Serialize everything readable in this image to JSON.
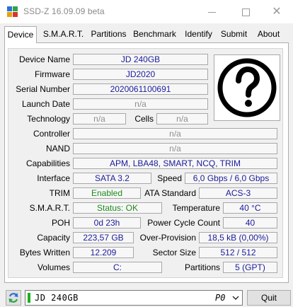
{
  "window": {
    "title": "SSD-Z 16.09.09 beta"
  },
  "tabs": [
    {
      "label": "Device"
    },
    {
      "label": "S.M.A.R.T."
    },
    {
      "label": "Partitions"
    },
    {
      "label": "Benchmark"
    },
    {
      "label": "Identify"
    },
    {
      "label": "Submit"
    },
    {
      "label": "About"
    }
  ],
  "device": {
    "device_name_label": "Device Name",
    "device_name": "JD 240GB",
    "firmware_label": "Firmware",
    "firmware": "JD2020",
    "serial_label": "Serial Number",
    "serial": "2020061100691",
    "launch_label": "Launch Date",
    "launch": "n/a",
    "technology_label": "Technology",
    "technology": "n/a",
    "cells_label": "Cells",
    "cells": "n/a",
    "controller_label": "Controller",
    "controller": "n/a",
    "nand_label": "NAND",
    "nand": "n/a",
    "capabilities_label": "Capabilities",
    "capabilities": "APM, LBA48, SMART, NCQ, TRIM",
    "interface_label": "Interface",
    "interface": "SATA 3.2",
    "speed_label": "Speed",
    "speed": "6,0 Gbps / 6,0 Gbps",
    "trim_label": "TRIM",
    "trim": "Enabled",
    "ata_label": "ATA Standard",
    "ata": "ACS-3",
    "smart_label": "S.M.A.R.T.",
    "smart": "Status: OK",
    "temp_label": "Temperature",
    "temp": "40 °C",
    "poh_label": "POH",
    "poh": "0d 23h",
    "pcc_label": "Power Cycle Count",
    "pcc": "40",
    "capacity_label": "Capacity",
    "capacity": "223,57 GB",
    "overprov_label": "Over-Provision",
    "overprov": "18,5 kB (0,00%)",
    "bytes_label": "Bytes Written",
    "bytes": "12.209",
    "sector_label": "Sector Size",
    "sector": "512 / 512",
    "volumes_label": "Volumes",
    "volumes": "C:",
    "partitions_label": "Partitions",
    "partitions": "5 (GPT)"
  },
  "bottom": {
    "drive_name": "JD 240GB",
    "drive_port": "P0",
    "quit_label": "Quit"
  },
  "colors": {
    "status_green": "#1d8a1d",
    "drive_indicator": "#19b219"
  },
  "icons": {
    "app": "ssdz-app-icon",
    "unknown_vendor": "question-mark-icon",
    "refresh": "refresh-icon",
    "dropdown": "chevron-down-icon"
  }
}
